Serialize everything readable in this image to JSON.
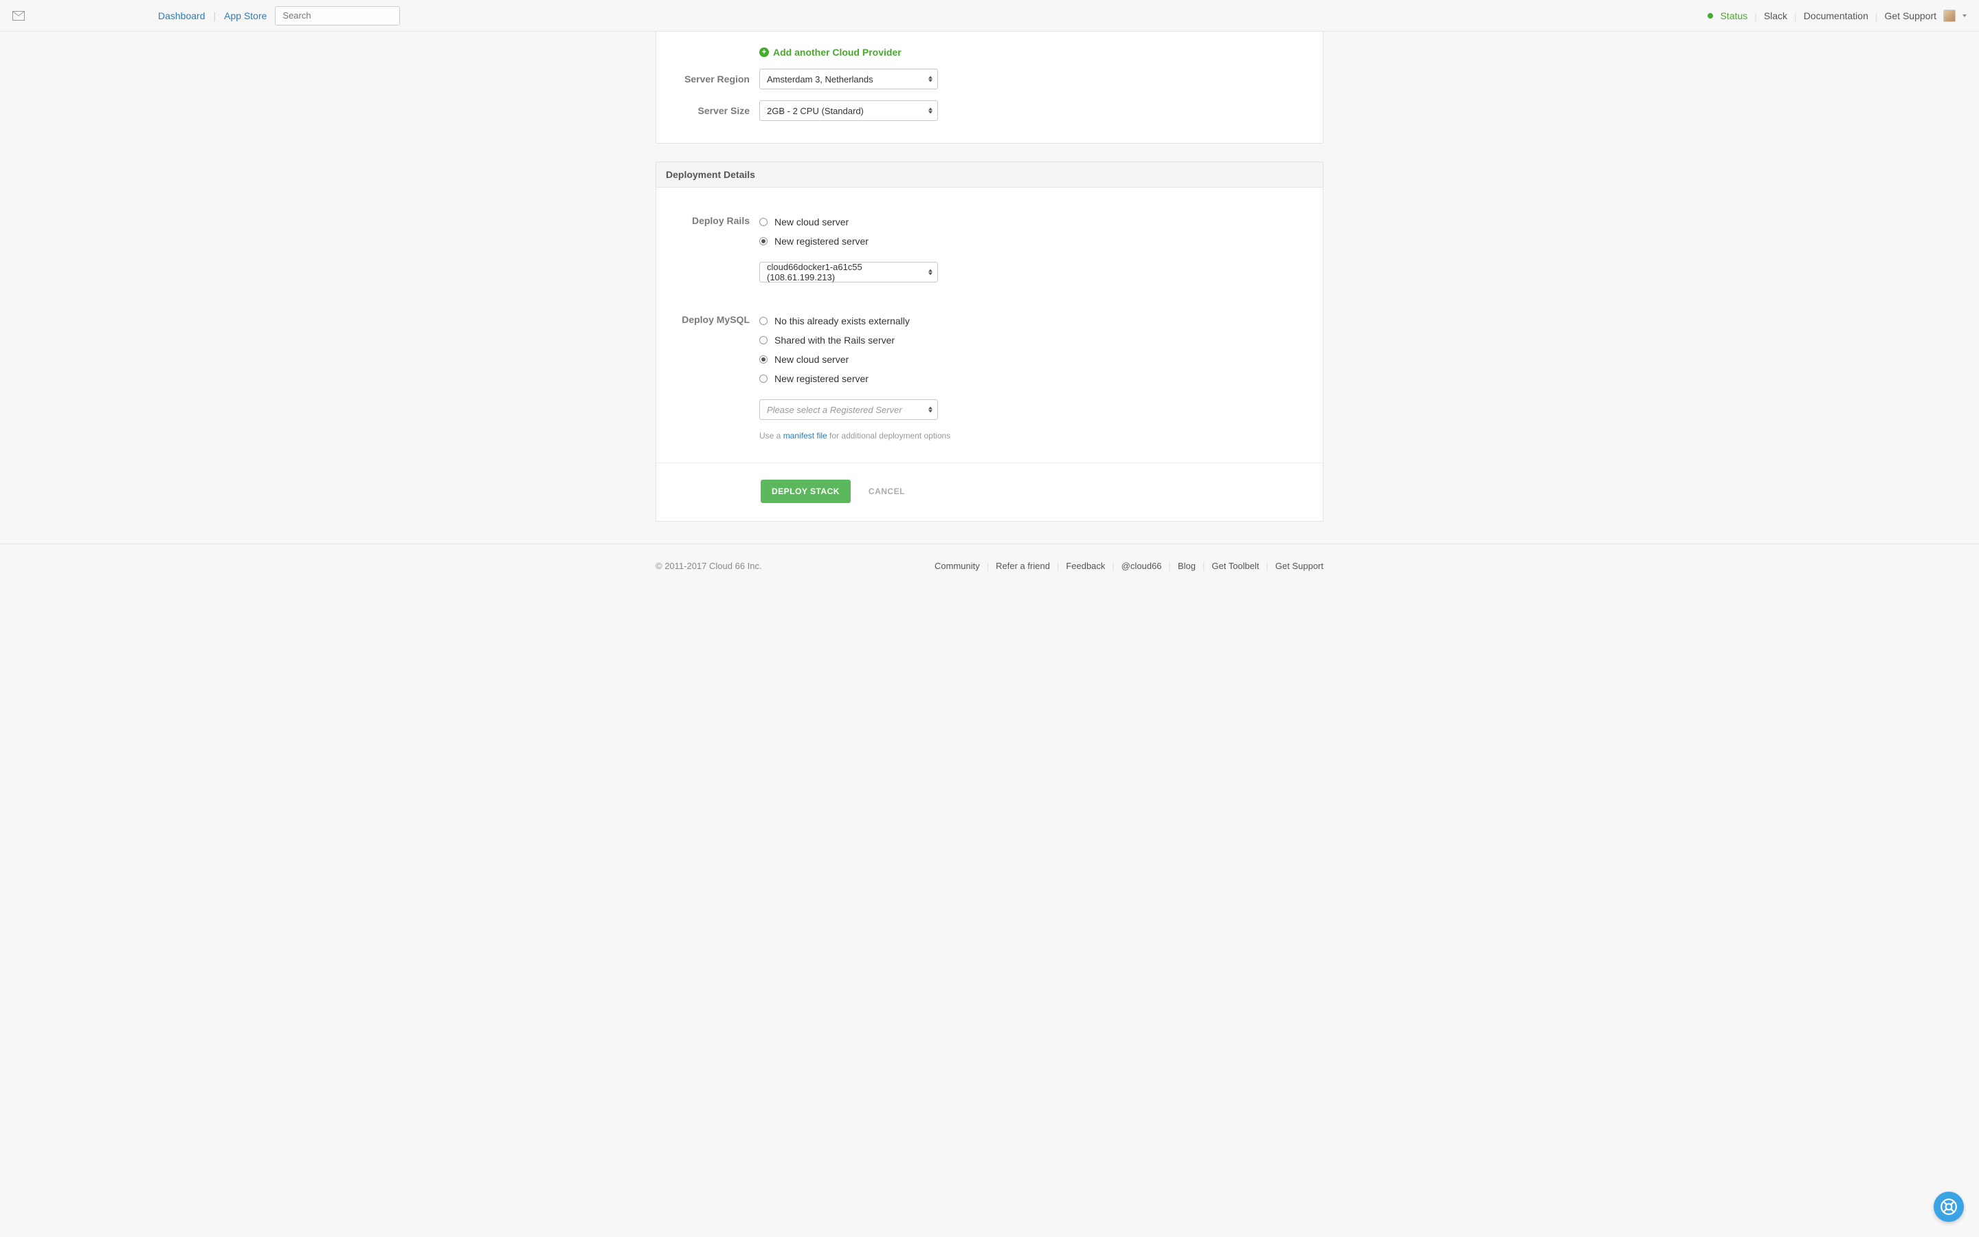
{
  "nav": {
    "dashboard": "Dashboard",
    "app_store": "App Store",
    "search_placeholder": "Search",
    "status": "Status",
    "slack": "Slack",
    "documentation": "Documentation",
    "get_support": "Get Support"
  },
  "cloud": {
    "add_link": "Add another Cloud Provider",
    "region_label": "Server Region",
    "region_value": "Amsterdam 3, Netherlands",
    "size_label": "Server Size",
    "size_value": "2GB - 2 CPU (Standard)"
  },
  "details": {
    "header": "Deployment Details",
    "rails_label": "Deploy Rails",
    "rails_options": {
      "new_cloud": "New cloud server",
      "new_registered": "New registered server"
    },
    "rails_server_value": "cloud66docker1-a61c55 (108.61.199.213)",
    "mysql_label": "Deploy MySQL",
    "mysql_options": {
      "external": "No this already exists externally",
      "shared": "Shared with the Rails server",
      "new_cloud": "New cloud server",
      "new_registered": "New registered server"
    },
    "mysql_server_placeholder": "Please select a Registered Server",
    "hint_prefix": "Use a ",
    "hint_link": "manifest file",
    "hint_suffix": " for additional deployment options"
  },
  "actions": {
    "deploy": "DEPLOY STACK",
    "cancel": "CANCEL"
  },
  "footer": {
    "copyright": "© 2011-2017 Cloud 66 Inc.",
    "links": {
      "community": "Community",
      "refer": "Refer a friend",
      "feedback": "Feedback",
      "twitter": "@cloud66",
      "blog": "Blog",
      "toolbelt": "Get Toolbelt",
      "support": "Get Support"
    }
  }
}
